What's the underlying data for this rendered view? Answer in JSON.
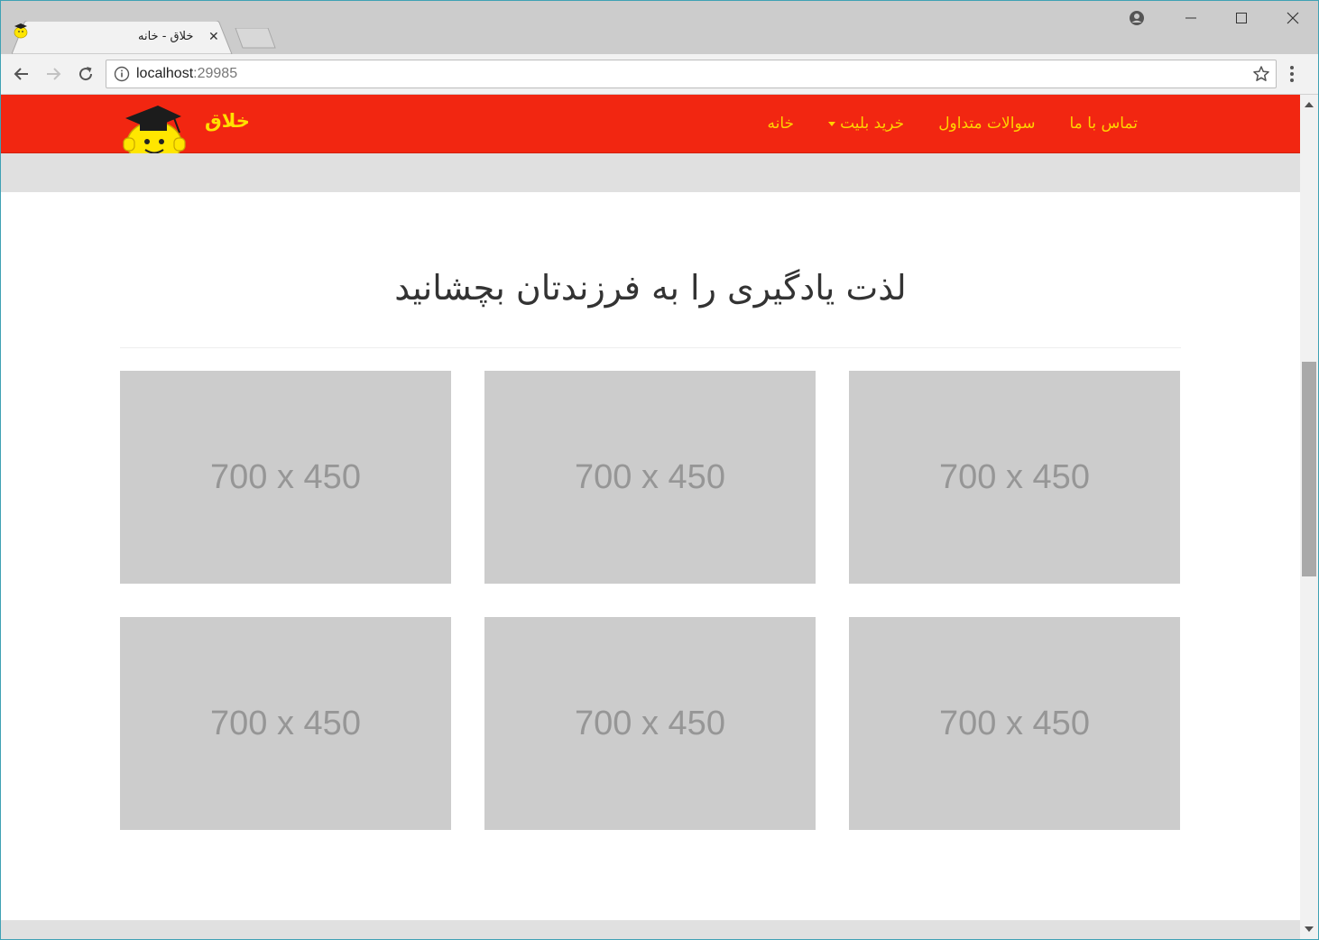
{
  "browser": {
    "tab_title": "خلاق - خانه",
    "url_host": "localhost",
    "url_port": ":29985"
  },
  "site": {
    "brand": "خلاق",
    "nav": [
      {
        "label": "خانه",
        "dropdown": false
      },
      {
        "label": "خرید بلیت",
        "dropdown": true
      },
      {
        "label": "سوالات متداول",
        "dropdown": false
      },
      {
        "label": "تماس با ما",
        "dropdown": false
      }
    ],
    "heading": "لذت یادگیری را به فرزندتان بچشانید",
    "placeholders": [
      "700 x 450",
      "700 x 450",
      "700 x 450",
      "700 x 450",
      "700 x 450",
      "700 x 450"
    ]
  },
  "colors": {
    "navbar_bg": "#f22611",
    "nav_text": "#ffd200",
    "placeholder_bg": "#cccccc",
    "placeholder_text": "#969696"
  }
}
